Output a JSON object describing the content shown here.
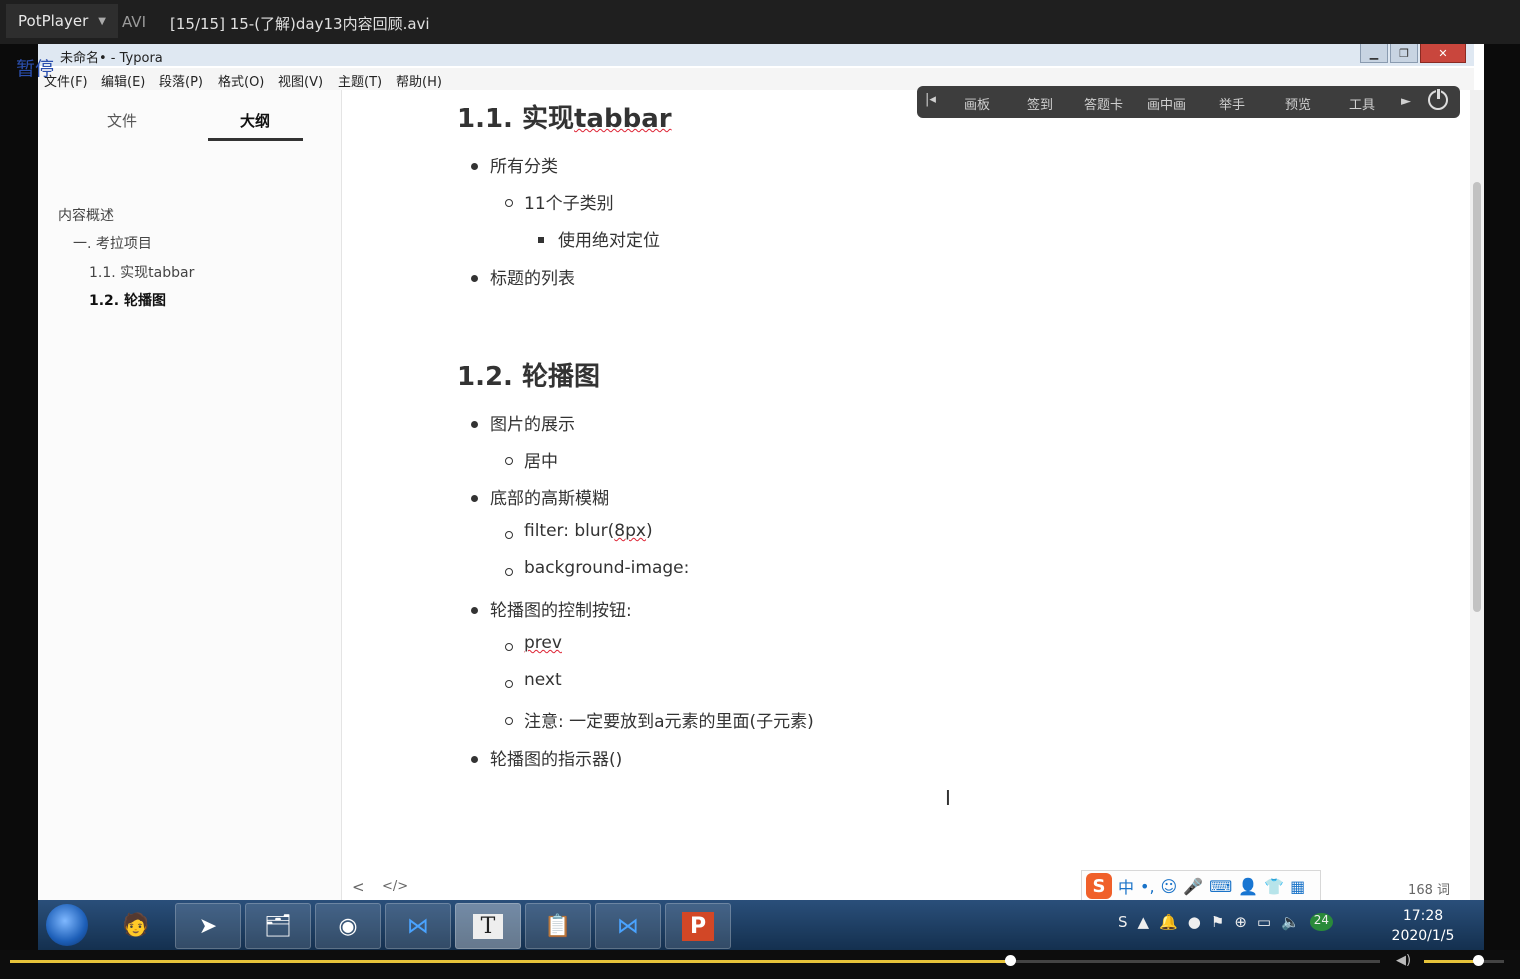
{
  "player": {
    "app_name": "PotPlayer",
    "format": "AVI",
    "filename": "[15/15] 15-(了解)day13内容回顾.avi",
    "state_label": "暂停",
    "seek_progress": 0.73,
    "volume": 0.68
  },
  "typora": {
    "title": "未命名• - Typora",
    "menu": [
      "文件(F)",
      "编辑(E)",
      "段落(P)",
      "格式(O)",
      "视图(V)",
      "主题(T)",
      "帮助(H)"
    ],
    "sidebar": {
      "tabs": [
        "文件",
        "大纲"
      ],
      "active_tab": "大纲",
      "outline": [
        "内容概述",
        "一. 考拉项目",
        "1.1. 实现tabbar",
        "1.2. 轮播图"
      ],
      "active_outline": "1.2. 轮播图"
    },
    "doc": {
      "h_tabbar": "1.1. 实现tabbar",
      "l_all_categories": "所有分类",
      "l_11_sub": "11个子类别",
      "l_abs_pos": "使用绝对定位",
      "l_title_list": "标题的列表",
      "h_carousel": "1.2. 轮播图",
      "l_image_show": "图片的展示",
      "l_center": "居中",
      "l_bottom_blur": "底部的高斯模糊",
      "l_filter": "filter: blur(8px)",
      "l_bg_image": "background-image:",
      "l_control_btn": "轮播图的控制按钮:",
      "l_prev": "prev",
      "l_next": "next",
      "l_note": "注意: 一定要放到a元素的里面(子元素)",
      "l_indicator": "轮播图的指示器()"
    },
    "footer": {
      "prev": "<",
      "code": "</>",
      "word_count": "168 词"
    }
  },
  "class_toolbar": [
    "画板",
    "签到",
    "答题卡",
    "画中画",
    "举手",
    "预览",
    "工具"
  ],
  "ime": {
    "mode": "中",
    "punct": "•,"
  },
  "taskbar": {
    "apps": [
      "start",
      "avatar",
      "app-arrow",
      "file-explorer",
      "chrome",
      "vscode",
      "typora",
      "notepad",
      "vscode-2",
      "powerpoint"
    ],
    "typora_letter": "T",
    "ppt_letter": "P",
    "badge": "24",
    "time": "17:28",
    "date": "2020/1/5"
  }
}
